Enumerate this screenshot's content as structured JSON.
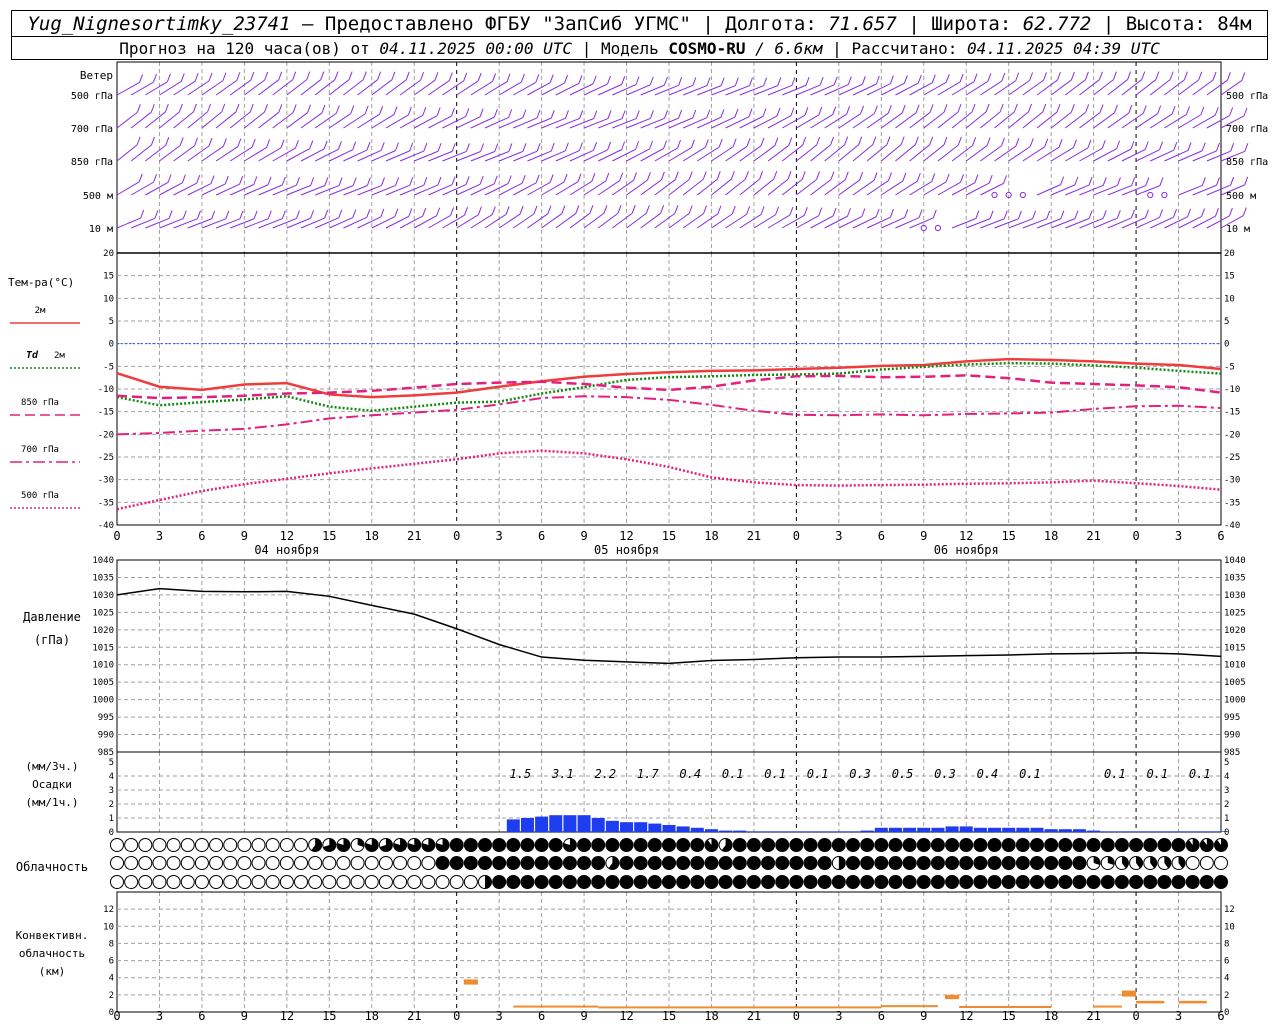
{
  "header": {
    "station": "Yug_Nignesortimky_23741",
    "provider": "— Предоставлено ФГБУ \"ЗапСиб УГМС\"",
    "lon_label": "| Долгота:",
    "lon": "71.657",
    "lat_label": "| Широта:",
    "lat": "62.772",
    "alt_label": "| Высота:",
    "alt": "84м",
    "forecast_label": "Прогноз на 120 часа(ов) от",
    "forecast_start": "04.11.2025 00:00 UTC",
    "model_label": "| Модель",
    "model": "COSMO-RU",
    "resolution": "/ 6.6км",
    "calc_label": "| Рассчитано:",
    "calc_time": "04.11.2025 04:39 UTC"
  },
  "chart_data": [
    {
      "type": "wind_barbs",
      "title": "Ветер",
      "levels": [
        "500 гПа",
        "700 гПа",
        "850 гПа",
        "500 м",
        "10 м"
      ],
      "hours_step": 1,
      "calm_hours_500m": [
        62,
        63,
        64,
        73,
        74,
        85,
        86
      ],
      "calm_hours_10m": [
        57,
        58
      ]
    },
    {
      "type": "line",
      "ylabel": "Тем-ра(°C)",
      "ylim": [
        -40,
        20
      ],
      "yticks": [
        20,
        15,
        10,
        5,
        0,
        -5,
        -10,
        -15,
        -20,
        -25,
        -30,
        -35,
        -40
      ],
      "x_hours": [
        0,
        3,
        6,
        9,
        12,
        15,
        18,
        21,
        24,
        27,
        30,
        33,
        36,
        39,
        42,
        45,
        48,
        51,
        54,
        57,
        60,
        63,
        66,
        69,
        72,
        75,
        78
      ],
      "series": [
        {
          "name": "2м",
          "color": "#f03c3c",
          "style": "solid",
          "values": [
            -6.5,
            -9.5,
            -10.2,
            -9.0,
            -8.7,
            -11.2,
            -11.8,
            -11.4,
            -10.8,
            -9.5,
            -8.3,
            -7.3,
            -6.7,
            -6.3,
            -6.0,
            -5.9,
            -5.6,
            -5.3,
            -4.9,
            -4.7,
            -3.9,
            -3.4,
            -3.6,
            -3.9,
            -4.4,
            -4.7,
            -5.6
          ]
        },
        {
          "name": "Td 2м",
          "color": "#128812",
          "style": "dotted",
          "values": [
            -11.8,
            -13.6,
            -12.9,
            -12.3,
            -11.6,
            -13.9,
            -14.8,
            -13.9,
            -13.0,
            -12.8,
            -11.0,
            -9.6,
            -8.0,
            -7.4,
            -7.2,
            -6.9,
            -6.8,
            -6.6,
            -5.7,
            -5.1,
            -4.6,
            -4.3,
            -4.4,
            -4.8,
            -5.3,
            -6.0,
            -6.6
          ]
        },
        {
          "name": "850 гПа",
          "color": "#e4207e",
          "style": "dashed",
          "values": [
            -11.5,
            -12.0,
            -11.8,
            -11.5,
            -11.0,
            -10.8,
            -10.4,
            -9.7,
            -8.9,
            -8.6,
            -8.4,
            -8.9,
            -9.7,
            -10.2,
            -9.5,
            -8.1,
            -7.2,
            -7.1,
            -7.4,
            -7.3,
            -7.0,
            -7.6,
            -8.6,
            -8.9,
            -9.2,
            -9.6,
            -10.8
          ]
        },
        {
          "name": "700 гПа",
          "color": "#e4207e",
          "style": "dashdot",
          "values": [
            -20.0,
            -19.7,
            -19.2,
            -18.8,
            -17.8,
            -16.5,
            -15.8,
            -15.2,
            -14.6,
            -13.4,
            -12.0,
            -11.6,
            -11.8,
            -12.4,
            -13.5,
            -14.8,
            -15.7,
            -15.8,
            -15.6,
            -15.8,
            -15.5,
            -15.4,
            -15.2,
            -14.4,
            -13.8,
            -13.7,
            -14.2
          ]
        },
        {
          "name": "500 гПа",
          "color": "#e4207e",
          "style": "dotted",
          "values": [
            -36.5,
            -34.5,
            -32.5,
            -31.0,
            -29.8,
            -28.6,
            -27.5,
            -26.5,
            -25.5,
            -24.2,
            -23.6,
            -24.2,
            -25.5,
            -27.2,
            -29.5,
            -30.6,
            -31.2,
            -31.3,
            -31.2,
            -31.1,
            -30.9,
            -30.8,
            -30.6,
            -30.2,
            -30.8,
            -31.4,
            -32.2
          ]
        }
      ]
    },
    {
      "type": "line",
      "ylabel": "Давление",
      "ylabel2": "(гПа)",
      "ylim": [
        985,
        1040
      ],
      "yticks": [
        1040,
        1035,
        1030,
        1025,
        1020,
        1015,
        1010,
        1005,
        1000,
        995,
        990,
        985
      ],
      "x_hours": [
        0,
        3,
        6,
        9,
        12,
        15,
        18,
        21,
        24,
        27,
        30,
        33,
        36,
        39,
        42,
        45,
        48,
        51,
        54,
        57,
        60,
        63,
        66,
        69,
        72,
        75,
        78
      ],
      "series": [
        {
          "name": "",
          "color": "#000000",
          "values": [
            1030,
            1031.8,
            1031.0,
            1030.9,
            1031.0,
            1029.6,
            1027.0,
            1024.5,
            1020.3,
            1015.8,
            1012.2,
            1011.3,
            1010.8,
            1010.4,
            1011.2,
            1011.5,
            1012.0,
            1012.2,
            1012.2,
            1012.4,
            1012.6,
            1012.8,
            1013.1,
            1013.2,
            1013.4,
            1013.1,
            1012.4
          ]
        }
      ]
    },
    {
      "type": "bar",
      "ylabel": "Осадки",
      "unit3": "(мм/3ч.)",
      "unit1": "(мм/1ч.)",
      "ylim": [
        0,
        5
      ],
      "yticks": [
        5,
        4,
        3,
        2,
        1,
        0
      ],
      "sums_3h": [
        {
          "h": 28.5,
          "v": "1.5"
        },
        {
          "h": 31.5,
          "v": "3.1"
        },
        {
          "h": 34.5,
          "v": "2.2"
        },
        {
          "h": 37.5,
          "v": "1.7"
        },
        {
          "h": 40.5,
          "v": "0.4"
        },
        {
          "h": 43.5,
          "v": "0.1"
        },
        {
          "h": 46.5,
          "v": "0.1"
        },
        {
          "h": 49.5,
          "v": "0.1"
        },
        {
          "h": 52.5,
          "v": "0.3"
        },
        {
          "h": 55.5,
          "v": "0.5"
        },
        {
          "h": 58.5,
          "v": "0.3"
        },
        {
          "h": 61.5,
          "v": "0.4"
        },
        {
          "h": 64.5,
          "v": "0.1"
        },
        {
          "h": 70.5,
          "v": "0.1"
        },
        {
          "h": 73.5,
          "v": "0.1"
        },
        {
          "h": 76.5,
          "v": "0.1"
        }
      ],
      "hourly_start": 28,
      "hourly": [
        0.9,
        1.0,
        1.1,
        1.2,
        1.2,
        1.2,
        1.0,
        0.8,
        0.7,
        0.7,
        0.6,
        0.5,
        0.4,
        0.3,
        0.2,
        0.1,
        0.1,
        0.05,
        0.05,
        0.05,
        0.05,
        0.05,
        0.05,
        0.05,
        0.05,
        0.1,
        0.3,
        0.3,
        0.3,
        0.3,
        0.3,
        0.4,
        0.4,
        0.3,
        0.3,
        0.3,
        0.3,
        0.3,
        0.2,
        0.2,
        0.2,
        0.1,
        0.05,
        0.05,
        0.05,
        0.05,
        0.05,
        0.05,
        0.05,
        0.05,
        0.05
      ]
    },
    {
      "type": "symbol_grid",
      "ylabel": "Облачность",
      "rows": [
        {
          "start_hour": 0,
          "values": [
            0,
            0,
            0,
            0,
            0,
            0,
            0,
            0,
            0,
            0,
            0,
            0,
            0,
            0,
            0,
            0,
            0,
            0,
            0,
            0,
            0,
            0,
            0,
            0,
            0,
            0,
            0,
            0,
            0,
            0,
            0,
            0,
            0,
            0,
            0,
            0,
            0,
            0,
            0,
            0,
            0,
            0,
            0,
            0,
            0,
            0,
            0,
            0,
            0,
            0,
            0,
            0,
            0,
            0,
            0,
            0,
            0,
            0,
            0,
            0,
            0,
            0,
            0,
            0,
            0,
            0,
            0,
            0,
            0,
            0,
            0,
            0,
            0,
            0,
            0,
            0,
            0,
            0,
            0
          ]
        },
        {
          "start_hour": 0,
          "values": [
            0,
            0,
            0,
            0,
            0,
            0,
            0,
            0,
            0,
            0,
            0,
            0,
            0,
            0,
            0,
            0,
            0,
            0,
            0,
            0,
            0,
            0,
            0,
            0,
            0,
            0,
            0,
            0,
            0,
            0,
            0,
            0,
            0,
            0,
            0,
            0,
            0,
            0,
            0,
            0,
            0,
            0,
            0,
            0,
            0,
            0,
            0,
            0,
            0,
            0,
            0,
            0,
            0,
            0,
            0,
            0,
            0,
            0,
            0,
            0,
            0,
            0,
            0,
            0,
            0,
            0,
            0,
            0,
            0,
            0,
            0,
            0,
            0,
            0,
            0,
            0,
            0,
            0,
            0
          ]
        },
        {
          "start_hour": 0,
          "values": [
            0,
            0,
            0,
            0,
            0,
            0,
            0,
            0,
            0,
            0,
            0,
            0,
            0,
            0,
            0,
            0,
            0,
            0,
            0,
            0,
            0,
            0,
            0,
            0,
            0,
            0,
            0,
            0,
            0,
            0,
            0,
            0,
            0,
            0,
            0,
            0,
            0,
            0,
            0,
            0,
            0,
            0,
            0,
            0,
            0,
            0,
            0,
            0,
            0,
            0,
            0,
            0,
            0,
            0,
            0,
            0,
            0,
            0,
            0,
            0,
            0,
            0,
            0,
            0,
            0,
            0,
            0,
            0,
            0,
            0,
            0,
            0,
            0,
            0,
            0,
            0,
            0,
            0,
            0
          ]
        }
      ],
      "row_levels_rule": "high/middle/low cloud cover in eighths (0–8)",
      "high": "0x14,0.6,0.7,0.8,0.3,0.8,0.7,0.8,0.8,0.8,0.8,1x8,0.8,1x9,0.9,0.6,1x10,1x22,0.9,0.9,0.9,0.9,0.9,0.9,0.9",
      "mid": "0x23,1x12,0.6,1x15,0.5,1x17,0.3,0.3,0.4,0.4,0.4,0.4,0.4",
      "low": "0x26,0.5,1x52"
    },
    {
      "type": "bar",
      "ylabel": "Конвективн.",
      "ylabel2": "облачность",
      "ylabel3": "(км)",
      "ylim": [
        0,
        14
      ],
      "yticks": [
        12,
        10,
        8,
        6,
        4,
        2,
        0
      ],
      "segments": [
        {
          "h0": 24.5,
          "h1": 25.5,
          "base": 3.2,
          "top": 3.8,
          "color": "#f08c30"
        },
        {
          "h0": 28,
          "h1": 34,
          "base": 0.6,
          "top": 0.75,
          "color": "#f08c30"
        },
        {
          "h0": 34,
          "h1": 54,
          "base": 0.55,
          "top": 0.65,
          "color": "#f08c30"
        },
        {
          "h0": 54,
          "h1": 58,
          "base": 0.6,
          "top": 0.8,
          "color": "#f08c30"
        },
        {
          "h0": 58.5,
          "h1": 59.5,
          "base": 1.5,
          "top": 2.0,
          "color": "#f08c30"
        },
        {
          "h0": 59.5,
          "h1": 66,
          "base": 0.55,
          "top": 0.7,
          "color": "#f08c30"
        },
        {
          "h0": 69,
          "h1": 71,
          "base": 0.6,
          "top": 0.75,
          "color": "#f08c30"
        },
        {
          "h0": 71,
          "h1": 72,
          "base": 1.8,
          "top": 2.5,
          "color": "#f08c30"
        },
        {
          "h0": 72,
          "h1": 74,
          "base": 1.0,
          "top": 1.3,
          "color": "#f08c30"
        },
        {
          "h0": 75,
          "h1": 77,
          "base": 1.0,
          "top": 1.3,
          "color": "#f08c30"
        }
      ]
    }
  ],
  "x_axis": {
    "tick_labels": [
      "0",
      "3",
      "6",
      "9",
      "12",
      "15",
      "18",
      "21",
      "0",
      "3",
      "6",
      "9",
      "12",
      "15",
      "18",
      "21",
      "0",
      "3",
      "6",
      "9",
      "12",
      "15",
      "18",
      "21",
      "0",
      "3",
      "6"
    ],
    "dates": [
      {
        "label": "04 ноября",
        "hour": 12
      },
      {
        "label": "05 ноября",
        "hour": 36
      },
      {
        "label": "06 ноября",
        "hour": 60
      }
    ]
  },
  "colors": {
    "wind": "#8a2be2",
    "zero_line": "#3355ff",
    "grid": "#a0a0a0",
    "precip": "#1e3cf0",
    "conv": "#f08c30"
  }
}
